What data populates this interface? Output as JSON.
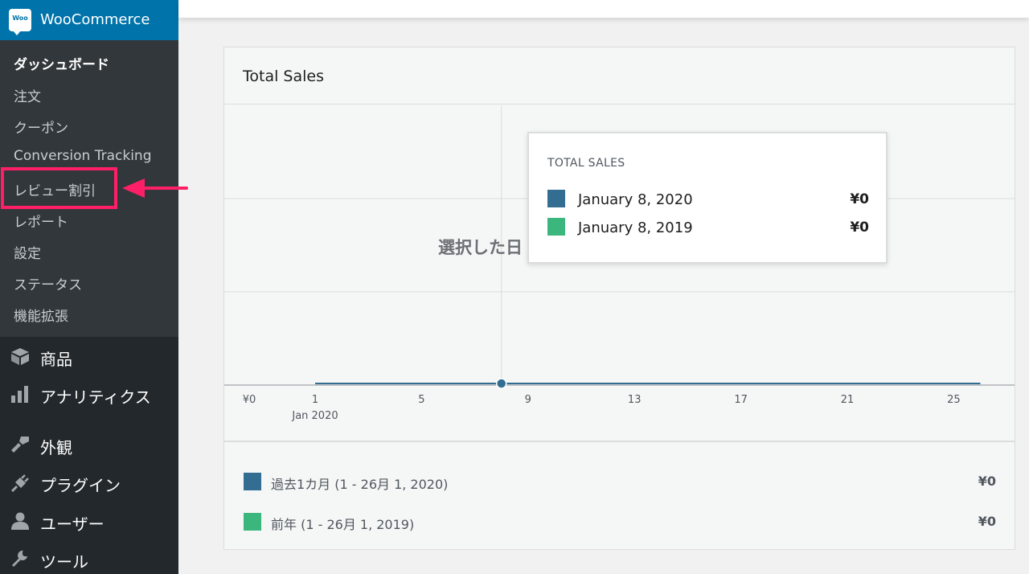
{
  "brand": {
    "title": "WooCommerce",
    "logo_text": "Woo",
    "logo_icon": "woo-bubble-icon"
  },
  "submenu": [
    {
      "label": "ダッシュボード",
      "current": true
    },
    {
      "label": "注文"
    },
    {
      "label": "クーポン"
    },
    {
      "label": "Conversion Tracking"
    },
    {
      "label": "レビュー割引"
    },
    {
      "label": "レポート"
    },
    {
      "label": "設定"
    },
    {
      "label": "ステータス"
    },
    {
      "label": "機能拡張"
    }
  ],
  "menu": [
    {
      "label": "商品",
      "icon": "archive-icon"
    },
    {
      "label": "アナリティクス",
      "icon": "bar-chart-icon"
    },
    {
      "label": "外観",
      "icon": "paint-brush-icon"
    },
    {
      "label": "プラグイン",
      "icon": "plugin-icon"
    },
    {
      "label": "ユーザー",
      "icon": "user-icon"
    },
    {
      "label": "ツール",
      "icon": "wrench-icon"
    }
  ],
  "annotation": {
    "highlight_color": "#ff1f66"
  },
  "card": {
    "title": "Total Sales",
    "overlay_text": "選択した日",
    "legend": [
      {
        "label": "過去1カ月 (1 - 26月 1, 2020)",
        "value": "¥0",
        "color": "#336e92"
      },
      {
        "label": "前年 (1 - 26月 1, 2019)",
        "value": "¥0",
        "color": "#3bb77e"
      }
    ]
  },
  "tooltip": {
    "title": "TOTAL SALES",
    "rows": [
      {
        "label": "January 8, 2020",
        "value": "¥0",
        "color": "#336e92"
      },
      {
        "label": "January 8, 2019",
        "value": "¥0",
        "color": "#3bb77e"
      }
    ]
  },
  "chart_data": {
    "type": "line",
    "title": "Total Sales",
    "ylabel": "",
    "x_ticks": [
      "1",
      "5",
      "9",
      "13",
      "17",
      "21",
      "25"
    ],
    "x_subtitle": "Jan 2020",
    "y_ticks": [
      "¥0"
    ],
    "x_domain": [
      1,
      26
    ],
    "grid": true,
    "hover_x": 8,
    "series": [
      {
        "name": "過去1カ月 (1 - 26月 1, 2020)",
        "color": "#336e92",
        "points": [
          [
            1,
            0
          ],
          [
            2,
            0
          ],
          [
            3,
            0
          ],
          [
            4,
            0
          ],
          [
            5,
            0
          ],
          [
            6,
            0
          ],
          [
            7,
            0
          ],
          [
            8,
            0
          ],
          [
            9,
            0
          ],
          [
            10,
            0
          ],
          [
            11,
            0
          ],
          [
            12,
            0
          ],
          [
            13,
            0
          ],
          [
            14,
            0
          ],
          [
            15,
            0
          ],
          [
            16,
            0
          ],
          [
            17,
            0
          ],
          [
            18,
            0
          ],
          [
            19,
            0
          ],
          [
            20,
            0
          ],
          [
            21,
            0
          ],
          [
            22,
            0
          ],
          [
            23,
            0
          ],
          [
            24,
            0
          ],
          [
            25,
            0
          ],
          [
            26,
            0
          ]
        ]
      },
      {
        "name": "前年 (1 - 26月 1, 2019)",
        "color": "#3bb77e",
        "points": [
          [
            1,
            0
          ],
          [
            2,
            0
          ],
          [
            3,
            0
          ],
          [
            4,
            0
          ],
          [
            5,
            0
          ],
          [
            6,
            0
          ],
          [
            7,
            0
          ],
          [
            8,
            0
          ],
          [
            9,
            0
          ],
          [
            10,
            0
          ],
          [
            11,
            0
          ],
          [
            12,
            0
          ],
          [
            13,
            0
          ],
          [
            14,
            0
          ],
          [
            15,
            0
          ],
          [
            16,
            0
          ],
          [
            17,
            0
          ],
          [
            18,
            0
          ],
          [
            19,
            0
          ],
          [
            20,
            0
          ],
          [
            21,
            0
          ],
          [
            22,
            0
          ],
          [
            23,
            0
          ],
          [
            24,
            0
          ],
          [
            25,
            0
          ],
          [
            26,
            0
          ]
        ]
      }
    ]
  }
}
